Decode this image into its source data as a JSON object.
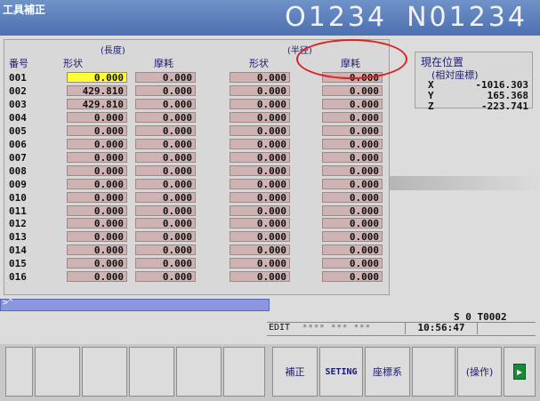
{
  "header": {
    "title": "工具補正",
    "program": "O1234",
    "sequence": "N01234"
  },
  "offset_table": {
    "section_length": "(長度)",
    "section_radius": "(半径)",
    "col_no": "番号",
    "col_len_geom": "形状",
    "col_len_wear": "摩耗",
    "col_rad_geom": "形状",
    "col_rad_wear": "摩耗",
    "selected_cell": "001 length geometry",
    "rows": [
      {
        "no": "001",
        "lg": "0.000",
        "lw": "0.000",
        "rg": "0.000",
        "rw": "0.000"
      },
      {
        "no": "002",
        "lg": "429.810",
        "lw": "0.000",
        "rg": "0.000",
        "rw": "0.000"
      },
      {
        "no": "003",
        "lg": "429.810",
        "lw": "0.000",
        "rg": "0.000",
        "rw": "0.000"
      },
      {
        "no": "004",
        "lg": "0.000",
        "lw": "0.000",
        "rg": "0.000",
        "rw": "0.000"
      },
      {
        "no": "005",
        "lg": "0.000",
        "lw": "0.000",
        "rg": "0.000",
        "rw": "0.000"
      },
      {
        "no": "006",
        "lg": "0.000",
        "lw": "0.000",
        "rg": "0.000",
        "rw": "0.000"
      },
      {
        "no": "007",
        "lg": "0.000",
        "lw": "0.000",
        "rg": "0.000",
        "rw": "0.000"
      },
      {
        "no": "008",
        "lg": "0.000",
        "lw": "0.000",
        "rg": "0.000",
        "rw": "0.000"
      },
      {
        "no": "009",
        "lg": "0.000",
        "lw": "0.000",
        "rg": "0.000",
        "rw": "0.000"
      },
      {
        "no": "010",
        "lg": "0.000",
        "lw": "0.000",
        "rg": "0.000",
        "rw": "0.000"
      },
      {
        "no": "011",
        "lg": "0.000",
        "lw": "0.000",
        "rg": "0.000",
        "rw": "0.000"
      },
      {
        "no": "012",
        "lg": "0.000",
        "lw": "0.000",
        "rg": "0.000",
        "rw": "0.000"
      },
      {
        "no": "013",
        "lg": "0.000",
        "lw": "0.000",
        "rg": "0.000",
        "rw": "0.000"
      },
      {
        "no": "014",
        "lg": "0.000",
        "lw": "0.000",
        "rg": "0.000",
        "rw": "0.000"
      },
      {
        "no": "015",
        "lg": "0.000",
        "lw": "0.000",
        "rg": "0.000",
        "rw": "0.000"
      },
      {
        "no": "016",
        "lg": "0.000",
        "lw": "0.000",
        "rg": "0.000",
        "rw": "0.000"
      }
    ]
  },
  "position": {
    "title": "現在位置",
    "subtitle": "(相対座標)",
    "axes": [
      {
        "axis": "X",
        "value": "-1016.303"
      },
      {
        "axis": "Y",
        "value": "165.368"
      },
      {
        "axis": "Z",
        "value": "-223.741"
      }
    ]
  },
  "input": {
    "prompt": ">^"
  },
  "status": {
    "spindle": "S     0 T0002",
    "mode": "EDIT",
    "stars": "**** *** ***",
    "clock": "10:56:47"
  },
  "softkeys": {
    "offset": "補正",
    "setting": "SETING",
    "work_coord": "座標系",
    "operation": "(操作)",
    "next_icon": "next-page-icon",
    "next_glyph": "▸"
  },
  "colors": {
    "selected": "#ffff33",
    "cell": "#cfb2b2",
    "header": "#4c70b0",
    "annotation": "#e02020"
  }
}
